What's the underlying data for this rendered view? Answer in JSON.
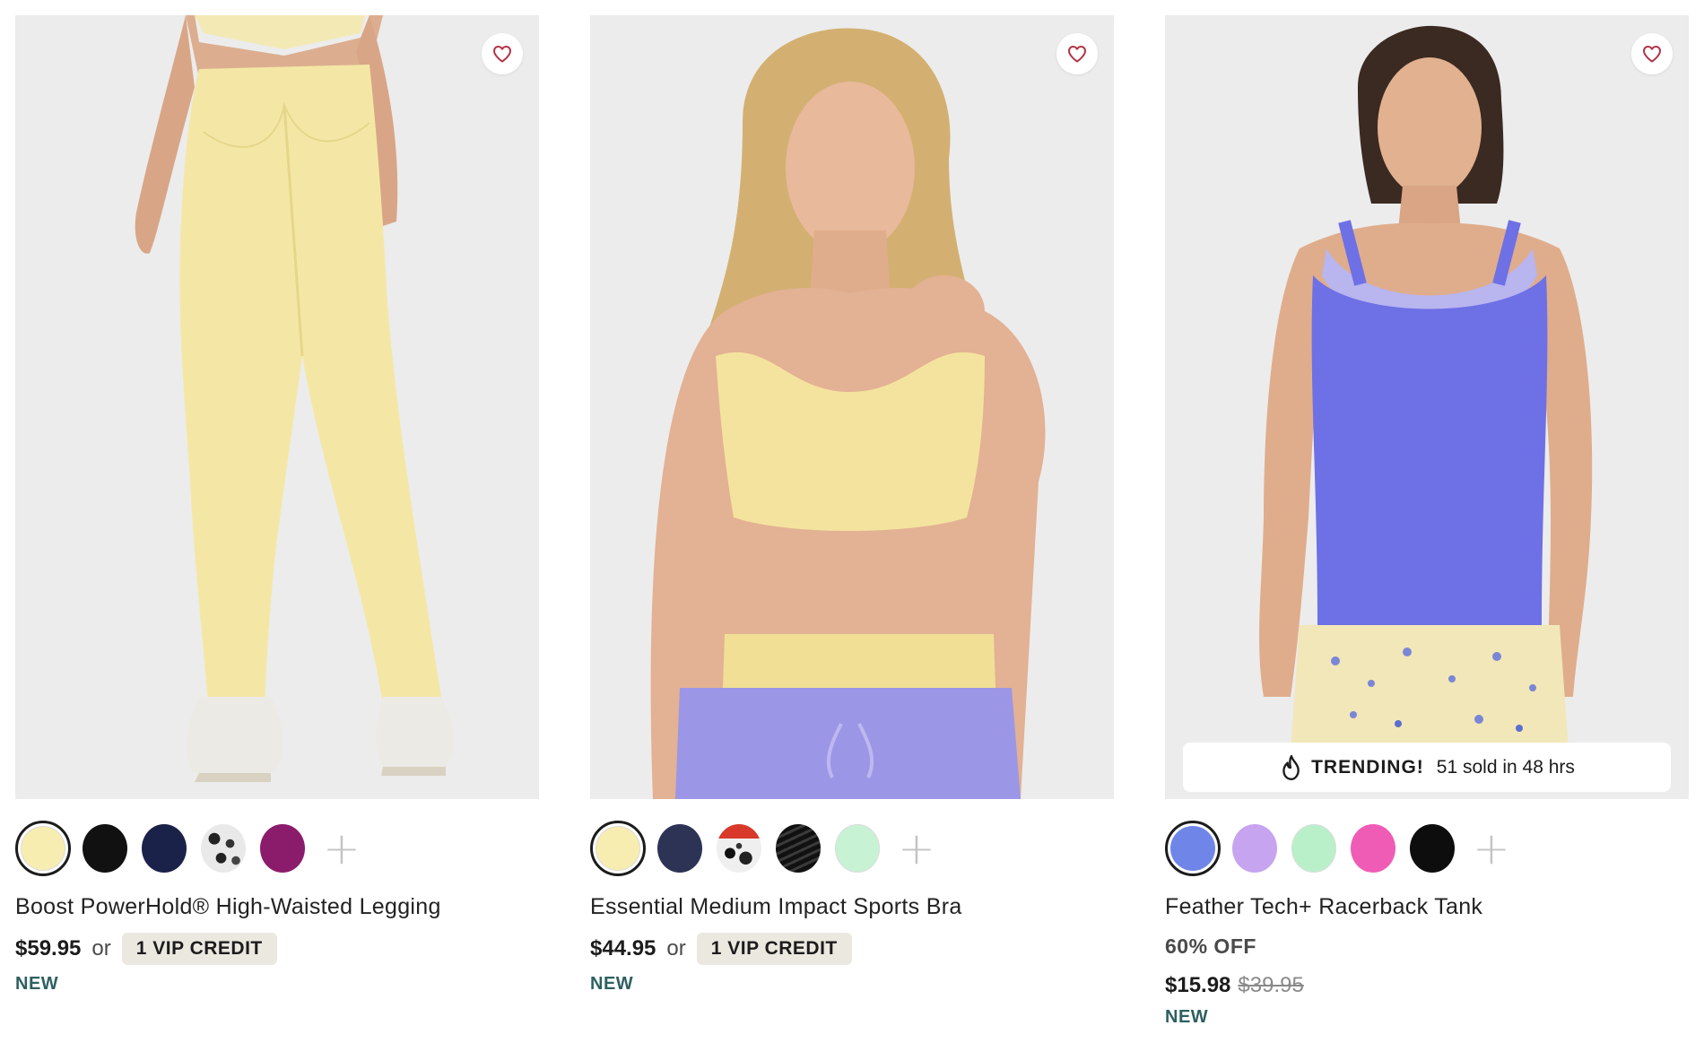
{
  "products": [
    {
      "name": "Boost PowerHold® High-Waisted Legging",
      "price": "$59.95",
      "or_label": "or",
      "vip_label": "1 VIP CREDIT",
      "badge": "NEW",
      "image_icon": "legging-model-photo",
      "favorite_icon": "heart-outline-icon",
      "swatches": [
        "#f8edb0",
        "#111111",
        "#1b2249",
        "leopard-print",
        "#8b1c6c"
      ],
      "selected_swatch": 0,
      "more_icon": "plus-icon"
    },
    {
      "name": "Essential Medium Impact Sports Bra",
      "price": "$44.95",
      "or_label": "or",
      "vip_label": "1 VIP CREDIT",
      "badge": "NEW",
      "image_icon": "sports-bra-model-photo",
      "favorite_icon": "heart-outline-icon",
      "swatches": [
        "#f8edb0",
        "#2c3355",
        "animal-print-red",
        "black-texture",
        "#c8f2d4"
      ],
      "selected_swatch": 0,
      "more_icon": "plus-icon"
    },
    {
      "name": "Feather Tech+ Racerback Tank",
      "discount": "60% OFF",
      "sale_price": "$15.98",
      "original_price": "$39.95",
      "badge": "NEW",
      "image_icon": "tank-top-model-photo",
      "favorite_icon": "heart-outline-icon",
      "trending_label": "TRENDING!",
      "trending_text": "51 sold in 48 hrs",
      "trending_icon": "flame-icon",
      "swatches": [
        "#6f86e8",
        "#c6a4ef",
        "#b9f0c9",
        "#ef5cb6",
        "#0d0d0d"
      ],
      "selected_swatch": 0,
      "more_icon": "plus-icon"
    }
  ],
  "colors": {
    "new_badge": "#2e6060",
    "vip_bg": "#ebe8e0",
    "heart": "#b33348"
  }
}
